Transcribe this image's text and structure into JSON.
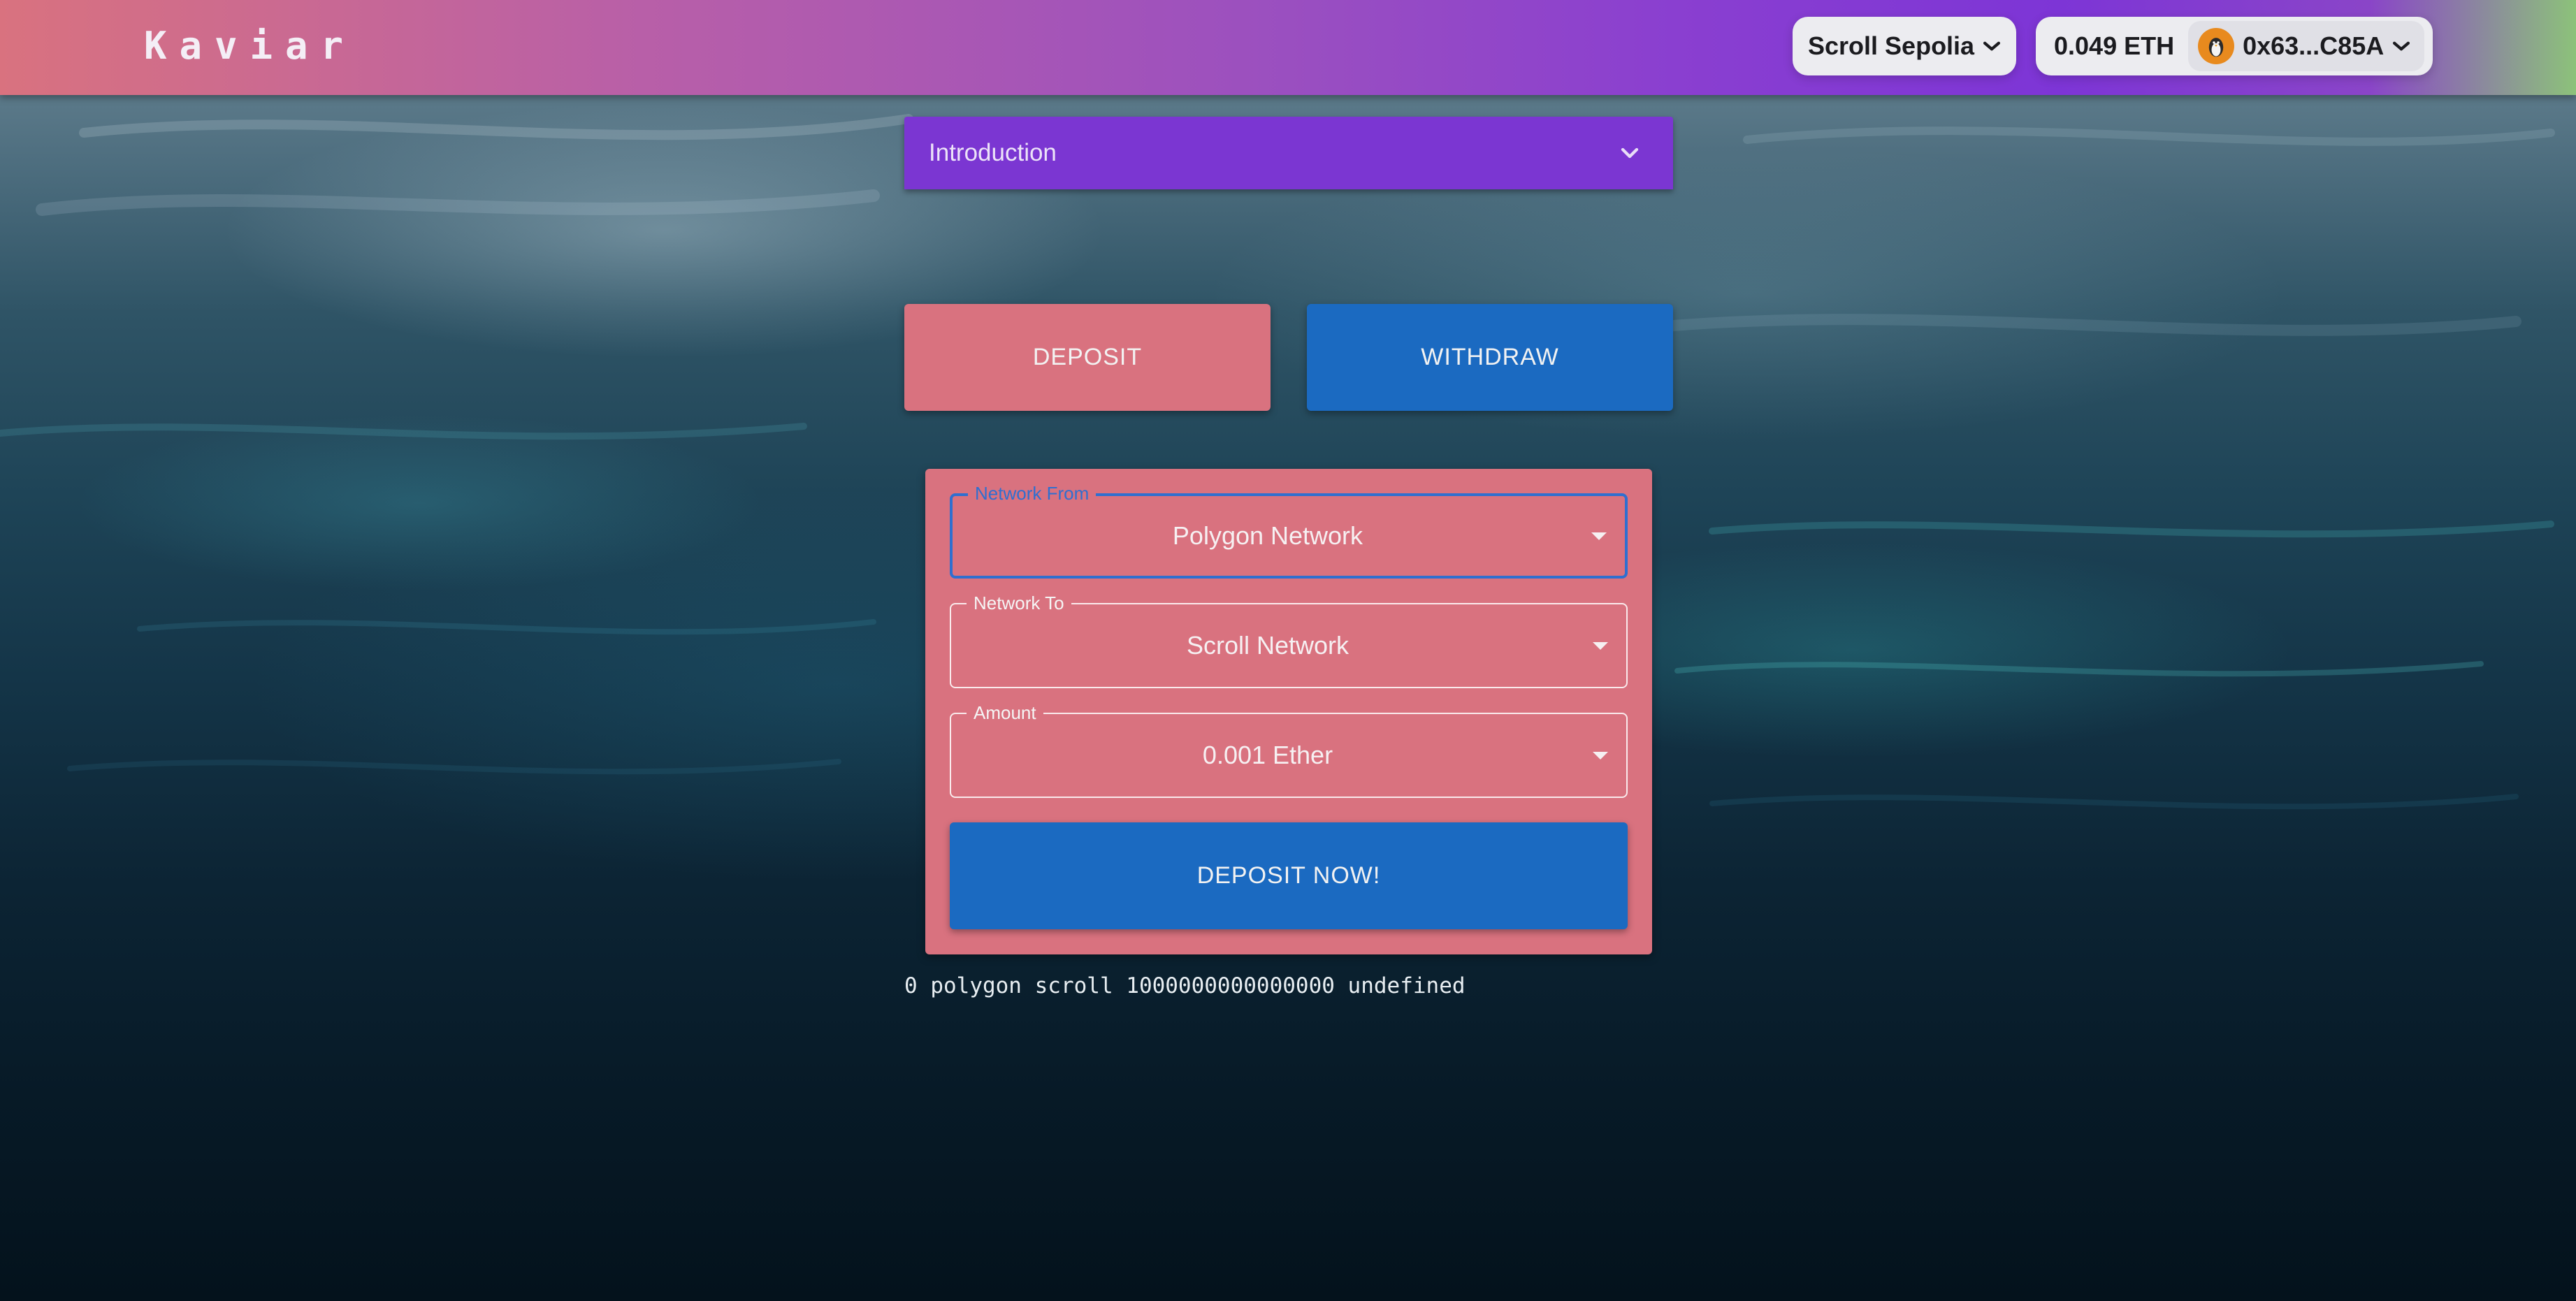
{
  "header": {
    "brand": "Kaviar",
    "network_selector": {
      "label": "Scroll Sepolia"
    },
    "account": {
      "balance": "0.049 ETH",
      "address": "0x63...C85A"
    }
  },
  "intro": {
    "label": "Introduction"
  },
  "tabs": {
    "deposit_label": "DEPOSIT",
    "withdraw_label": "WITHDRAW"
  },
  "form": {
    "network_from": {
      "label": "Network From",
      "value": "Polygon Network"
    },
    "network_to": {
      "label": "Network To",
      "value": "Scroll Network"
    },
    "amount": {
      "label": "Amount",
      "value": "0.001 Ether"
    },
    "submit_label": "DEPOSIT NOW!"
  },
  "debug_text": "0 polygon scroll 1000000000000000 undefined",
  "colors": {
    "header_gradient": [
      "#d9727f",
      "#8a3fd0",
      "#8cc27a"
    ],
    "intro_bg": "#7b36d2",
    "deposit_bg": "#d9727f",
    "withdraw_bg": "#1b6ac1",
    "focus_border": "#2f6fd0"
  },
  "icons": {
    "network_chevron": "chevron-down-icon",
    "account_chevron": "chevron-down-icon",
    "avatar": "penguin-avatar-icon",
    "intro_expand": "expand-more-icon",
    "select_caret": "caret-down-icon"
  }
}
